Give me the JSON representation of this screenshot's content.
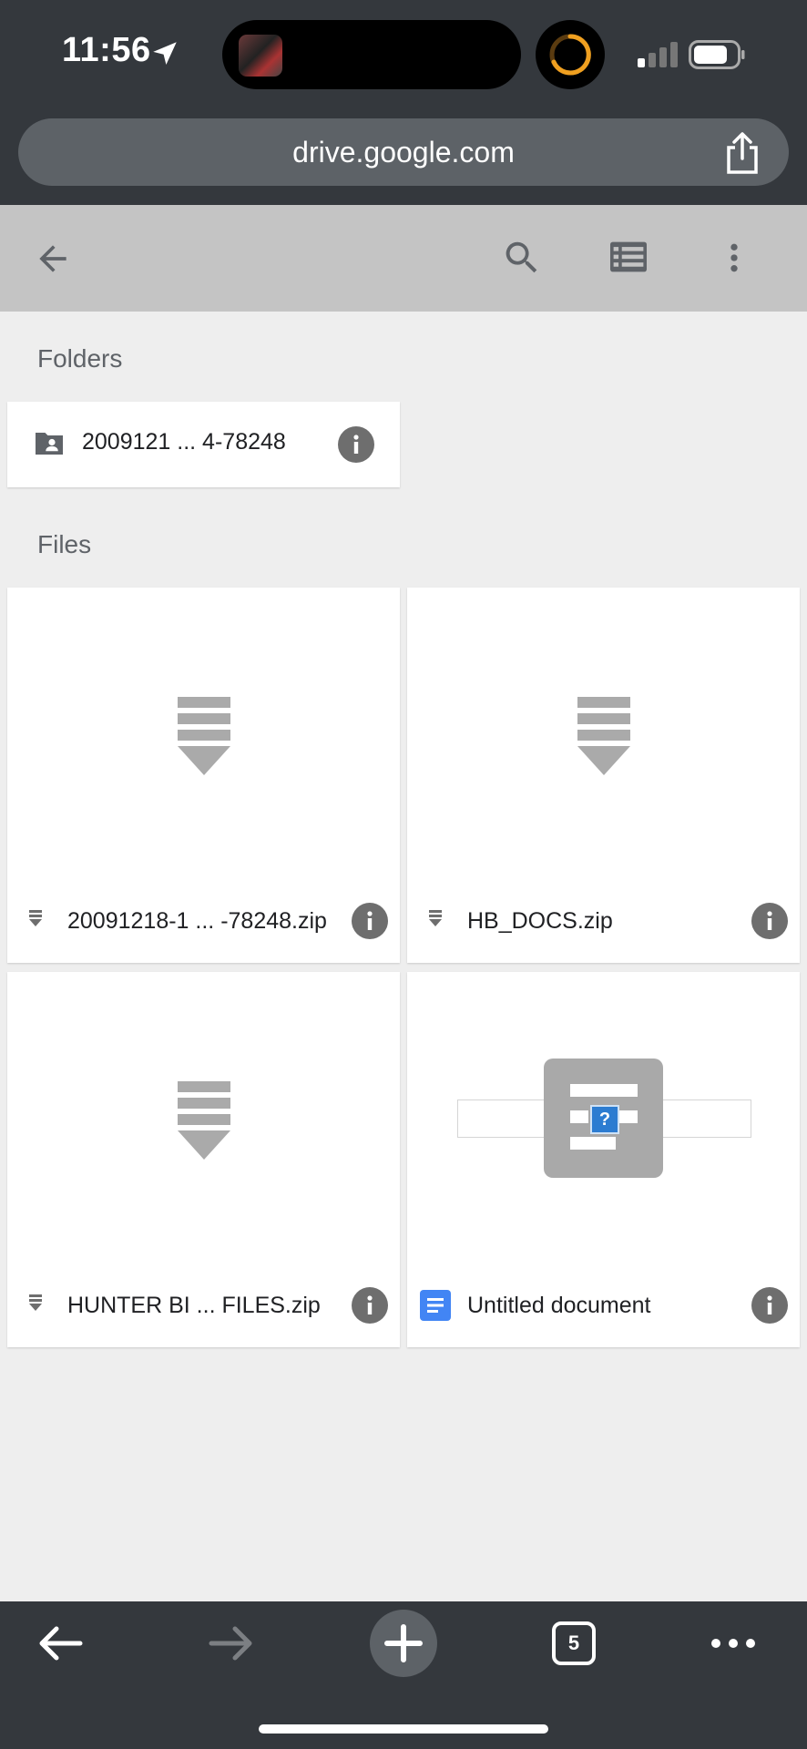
{
  "status_bar": {
    "time": "11:56",
    "location_icon": "location-arrow-icon",
    "signal_icon": "cellular-signal-icon",
    "battery_icon": "battery-icon"
  },
  "browser": {
    "url": "drive.google.com",
    "share_icon": "share-icon",
    "tab_count": "5"
  },
  "toolbar": {
    "back_icon": "arrow-back-icon",
    "search_icon": "search-icon",
    "list_view_icon": "list-view-icon",
    "more_icon": "more-vert-icon",
    "color": "#c4c4c4"
  },
  "folders_section": {
    "label": "Folders",
    "items": [
      {
        "name": "2009121 ... 4-78248",
        "icon": "shared-folder-icon"
      }
    ]
  },
  "files_section": {
    "label": "Files",
    "items": [
      {
        "name": "20091218-1 ... -78248.zip",
        "icon": "zip-file-icon"
      },
      {
        "name": "HB_DOCS.zip",
        "icon": "zip-file-icon"
      },
      {
        "name": "HUNTER BI ... FILES.zip",
        "icon": "zip-file-icon"
      },
      {
        "name": "Untitled document",
        "icon": "google-docs-icon",
        "thumb_mark": "?"
      }
    ]
  },
  "colors": {
    "browser_chrome": "#34383d",
    "docs_blue": "#4285f4",
    "info_gray": "#6e6e6e"
  }
}
